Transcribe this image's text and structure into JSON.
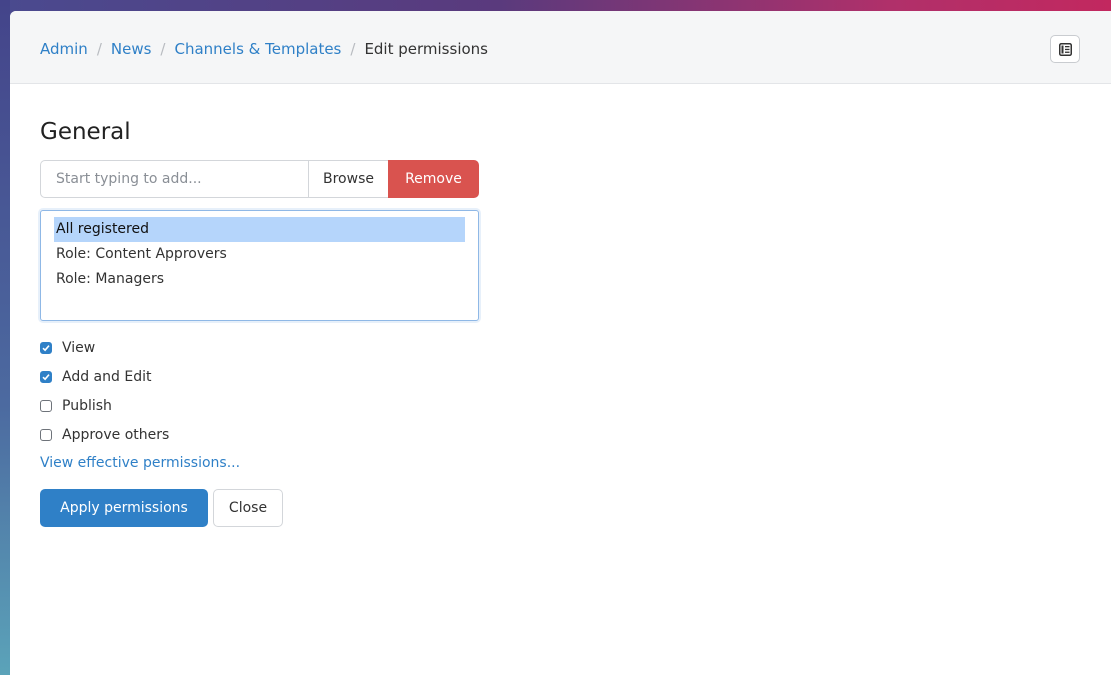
{
  "breadcrumb": {
    "items": [
      "Admin",
      "News",
      "Channels & Templates"
    ],
    "current": "Edit permissions"
  },
  "header": {
    "toggle_icon": "drawer-toggle-icon"
  },
  "main": {
    "heading": "General",
    "add": {
      "placeholder": "Start typing to add...",
      "browse_label": "Browse",
      "remove_label": "Remove"
    },
    "principals": [
      {
        "label": "All registered",
        "selected": true
      },
      {
        "label": "Role: Content Approvers",
        "selected": false
      },
      {
        "label": "Role: Managers",
        "selected": false
      }
    ],
    "permissions": [
      {
        "label": "View",
        "checked": true
      },
      {
        "label": "Add and Edit",
        "checked": true
      },
      {
        "label": "Publish",
        "checked": false
      },
      {
        "label": "Approve others",
        "checked": false
      }
    ],
    "effective_link": "View effective permissions...",
    "apply_label": "Apply permissions",
    "close_label": "Close"
  },
  "colors": {
    "link": "#2f80c7",
    "danger": "#d9534f",
    "primary": "#2f80c7",
    "selection": "#b5d5fb"
  }
}
